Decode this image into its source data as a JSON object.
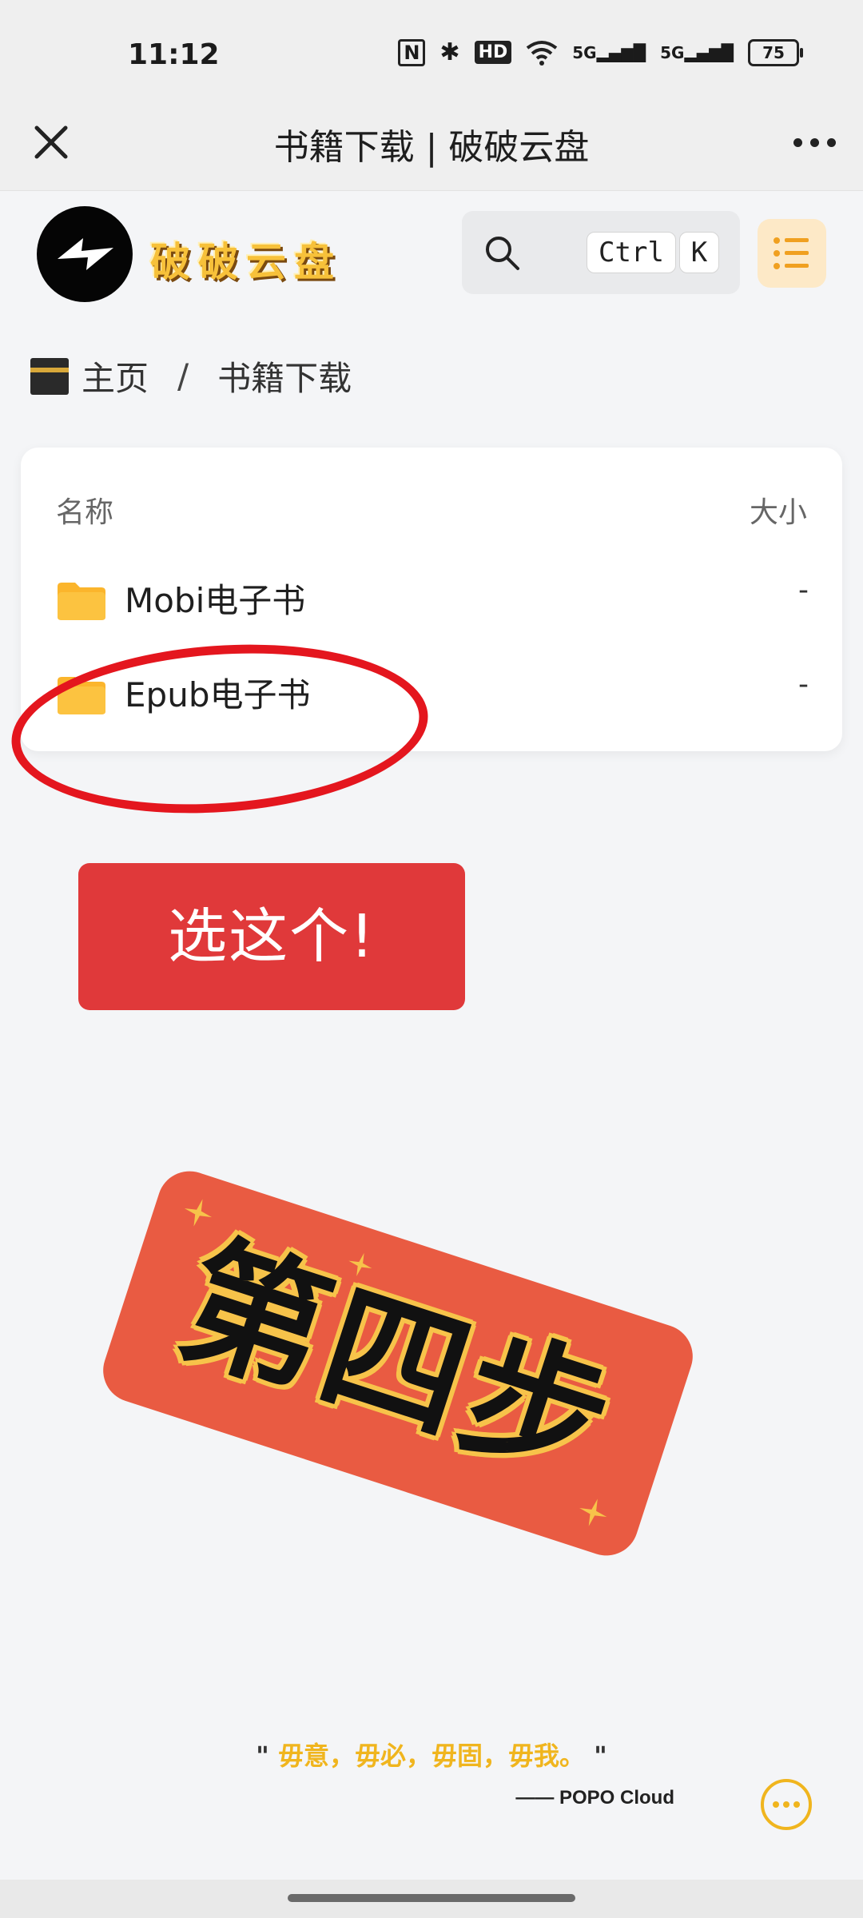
{
  "status_bar": {
    "time": "11:12",
    "nfc": "N",
    "bluetooth": "✱",
    "hd": "HD",
    "wifi": "📶",
    "signal_1": "5G",
    "signal_2": "5G",
    "battery": "75"
  },
  "title_bar": {
    "title": "书籍下载 | 破破云盘"
  },
  "site": {
    "logo_text": "破破云盘",
    "search_key_ctrl": "Ctrl",
    "search_key_k": "K"
  },
  "breadcrumb": {
    "home": "主页",
    "separator": "/",
    "current": "书籍下载"
  },
  "file_table": {
    "header_name": "名称",
    "header_size": "大小",
    "rows": [
      {
        "name": "Mobi电子书",
        "size": "-"
      },
      {
        "name": "Epub电子书",
        "size": "-"
      }
    ]
  },
  "overlay": {
    "select_button": "选这个!",
    "step_label": "第四步"
  },
  "footer": {
    "quote_open": "\"",
    "quote_text": "毋意，毋必，毋固，毋我。",
    "quote_close": "\"",
    "author": "—— POPO Cloud"
  },
  "colors": {
    "accent_yellow": "#f0b51e",
    "button_red": "#e0393a",
    "highlight_red": "#e4161e",
    "folder_yellow": "#fbb52c"
  }
}
